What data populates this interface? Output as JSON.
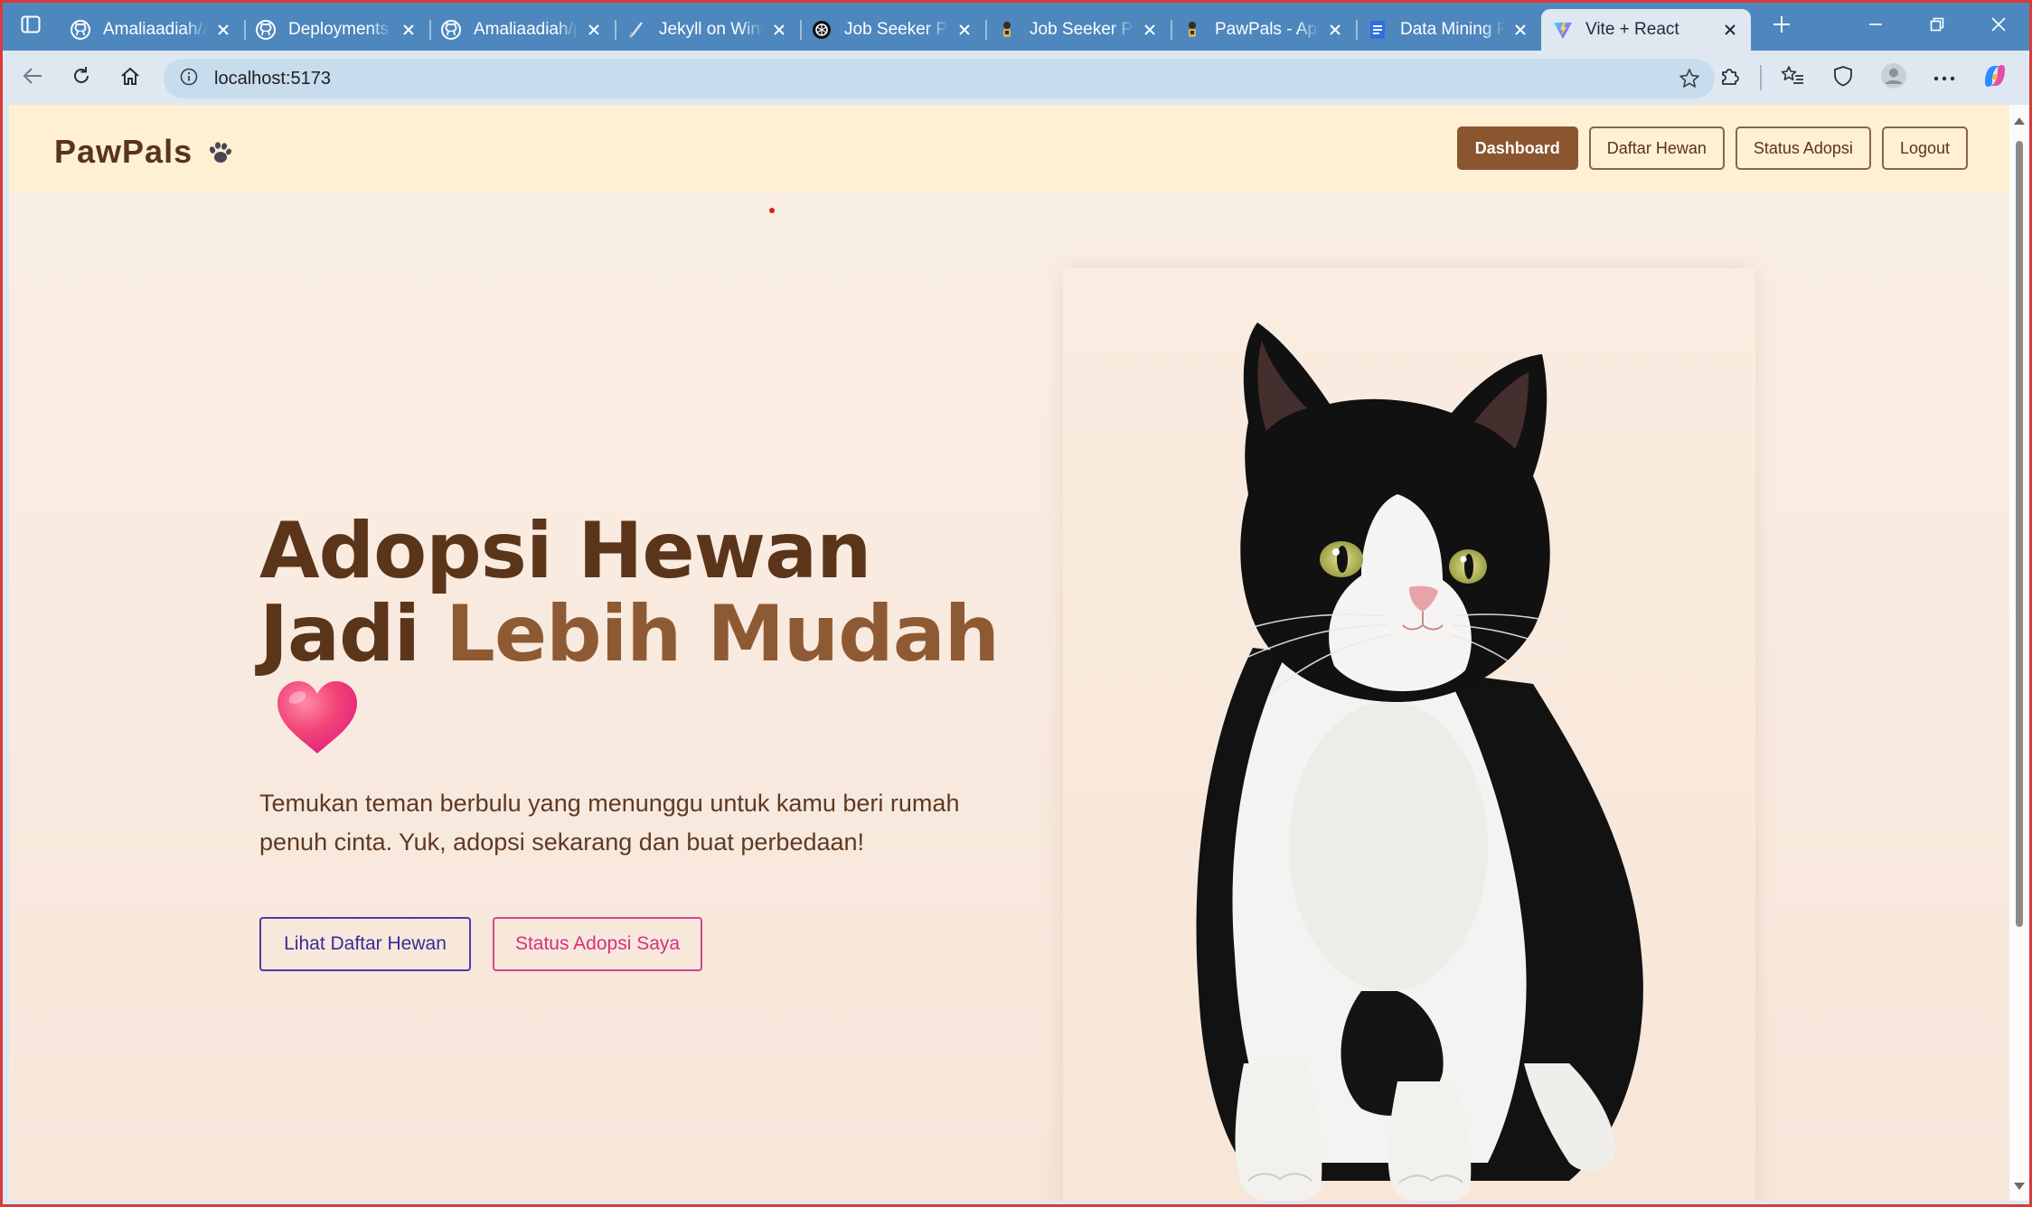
{
  "browser": {
    "tabs": [
      {
        "title": "Amaliaadiah/Adopsi",
        "icon": "github-icon"
      },
      {
        "title": "Deployments · Amaliaadiah",
        "icon": "github-icon"
      },
      {
        "title": "Amaliaadiah/pawpals",
        "icon": "github-icon"
      },
      {
        "title": "Jekyll on Windows",
        "icon": "pen-icon"
      },
      {
        "title": "Job Seeker Platform",
        "icon": "openai-icon"
      },
      {
        "title": "Job Seeker Platform",
        "icon": "app-icon"
      },
      {
        "title": "PawPals - Aplikasi",
        "icon": "app-icon"
      },
      {
        "title": "Data Mining Project",
        "icon": "docs-icon"
      },
      {
        "title": "Vite + React",
        "icon": "vite-icon",
        "active": true
      }
    ],
    "address": {
      "url": "localhost:5173"
    }
  },
  "nav": {
    "brand": "PawPals",
    "links": [
      {
        "label": "Dashboard",
        "active": true
      },
      {
        "label": "Daftar Hewan"
      },
      {
        "label": "Status Adopsi"
      },
      {
        "label": "Logout"
      }
    ]
  },
  "hero": {
    "title_line1": "Adopsi Hewan",
    "title_line2_prefix": "Jadi ",
    "title_line2_accent": "Lebih Mudah",
    "subtitle": "Temukan teman berbulu yang menunggu untuk kamu beri rumah penuh cinta. Yuk, adopsi sekarang dan buat perbedaan!",
    "primary_button": "Lihat Daftar Hewan",
    "secondary_button": "Status Adopsi Saya"
  },
  "colors": {
    "tabstrip": "#4d87bd",
    "navbar": "#fff0d4",
    "brand": "#5a3318",
    "accent_brown": "#8b5530",
    "button_indigo": "#4d3aa8",
    "button_pink": "#d8458e"
  }
}
